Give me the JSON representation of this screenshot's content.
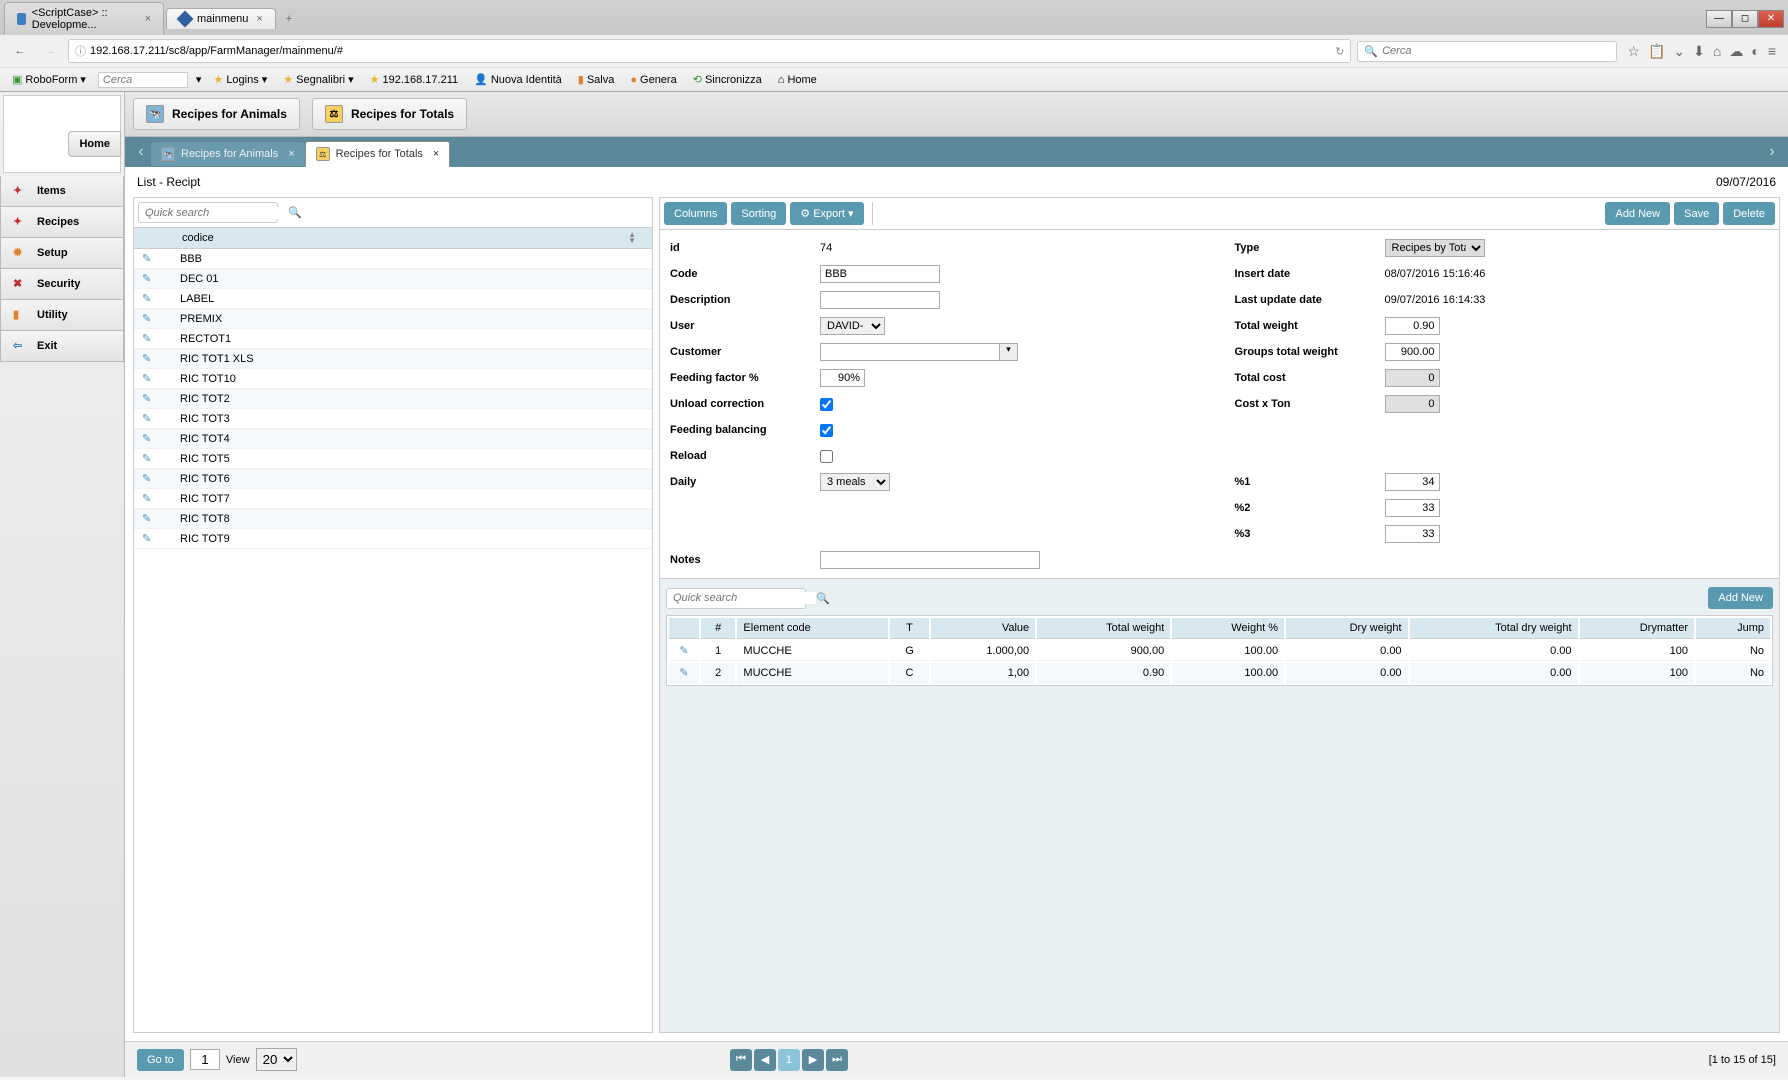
{
  "browser": {
    "tabs": [
      {
        "title": "<ScriptCase> :: Developme...",
        "active": false
      },
      {
        "title": "mainmenu",
        "active": true
      }
    ],
    "url": "192.168.17.211/sc8/app/FarmManager/mainmenu/#",
    "search_placeholder": "Cerca"
  },
  "bookmarks": {
    "roboform": "RoboForm",
    "search_placeholder": "Cerca",
    "logins": "Logins",
    "segnalibri": "Segnalibri",
    "ip": "192.168.17.211",
    "nuova": "Nuova Identità",
    "salva": "Salva",
    "genera": "Genera",
    "sincronizza": "Sincronizza",
    "home": "Home"
  },
  "sidebar": {
    "home": "Home",
    "items": [
      {
        "label": "Items",
        "icon": "items-icon"
      },
      {
        "label": "Recipes",
        "icon": "recipes-icon"
      },
      {
        "label": "Setup",
        "icon": "setup-icon"
      },
      {
        "label": "Security",
        "icon": "security-icon"
      },
      {
        "label": "Utility",
        "icon": "utility-icon"
      },
      {
        "label": "Exit",
        "icon": "exit-icon"
      }
    ]
  },
  "top_tabs": {
    "animals": "Recipes for Animals",
    "totals": "Recipes for Totals"
  },
  "sub_tabs": {
    "animals": "Recipes for Animals",
    "totals": "Recipes for Totals"
  },
  "header": {
    "title": "List - Recipt",
    "date": "09/07/2016"
  },
  "list": {
    "search_placeholder": "Quick search",
    "col_header": "codice",
    "rows": [
      "BBB",
      "DEC 01",
      "LABEL",
      "PREMIX",
      "RECTOT1",
      "RIC TOT1 XLS",
      "RIC TOT10",
      "RIC TOT2",
      "RIC TOT3",
      "RIC TOT4",
      "RIC TOT5",
      "RIC TOT6",
      "RIC TOT7",
      "RIC TOT8",
      "RIC TOT9"
    ]
  },
  "toolbar": {
    "columns": "Columns",
    "sorting": "Sorting",
    "export": "Export",
    "add_new": "Add New",
    "save": "Save",
    "delete": "Delete"
  },
  "form": {
    "labels": {
      "id": "id",
      "code": "Code",
      "description": "Description",
      "user": "User",
      "customer": "Customer",
      "feeding_factor": "Feeding factor %",
      "unload_correction": "Unload correction",
      "feeding_balancing": "Feeding balancing",
      "reload": "Reload",
      "daily": "Daily",
      "notes": "Notes",
      "type": "Type",
      "insert_date": "Insert date",
      "last_update": "Last update date",
      "total_weight": "Total weight",
      "groups_total_weight": "Groups total weight",
      "total_cost": "Total cost",
      "cost_x_ton": "Cost x Ton",
      "p1": "%1",
      "p2": "%2",
      "p3": "%3"
    },
    "values": {
      "id": "74",
      "code": "BBB",
      "description": "",
      "user": "DAVID-",
      "customer": "",
      "feeding_factor": "90%",
      "daily": "3 meals",
      "type": "Recipes by Totals",
      "insert_date": "08/07/2016 15:16:46",
      "last_update": "09/07/2016 16:14:33",
      "total_weight": "0.90",
      "groups_total_weight": "900.00",
      "total_cost": "0",
      "cost_x_ton": "0",
      "p1": "34",
      "p2": "33",
      "p3": "33",
      "notes": ""
    }
  },
  "sublist": {
    "search_placeholder": "Quick search",
    "add_new": "Add New",
    "headers": {
      "num": "#",
      "element_code": "Element code",
      "t": "T",
      "value": "Value",
      "total_weight": "Total weight",
      "weight_pct": "Weight %",
      "dry_weight": "Dry weight",
      "total_dry_weight": "Total dry weight",
      "drymatter": "Drymatter",
      "jump": "Jump"
    },
    "rows": [
      {
        "num": "1",
        "element_code": "MUCCHE",
        "t": "G",
        "value": "1.000,00",
        "total_weight": "900.00",
        "weight_pct": "100.00",
        "dry_weight": "0.00",
        "total_dry_weight": "0.00",
        "drymatter": "100",
        "jump": "No"
      },
      {
        "num": "2",
        "element_code": "MUCCHE",
        "t": "C",
        "value": "1,00",
        "total_weight": "0.90",
        "weight_pct": "100.00",
        "dry_weight": "0.00",
        "total_dry_weight": "0.00",
        "drymatter": "100",
        "jump": "No"
      }
    ]
  },
  "footer": {
    "goto": "Go to",
    "page": "1",
    "view": "View",
    "per_page": "20",
    "range": "[1 to 15 of 15]"
  }
}
